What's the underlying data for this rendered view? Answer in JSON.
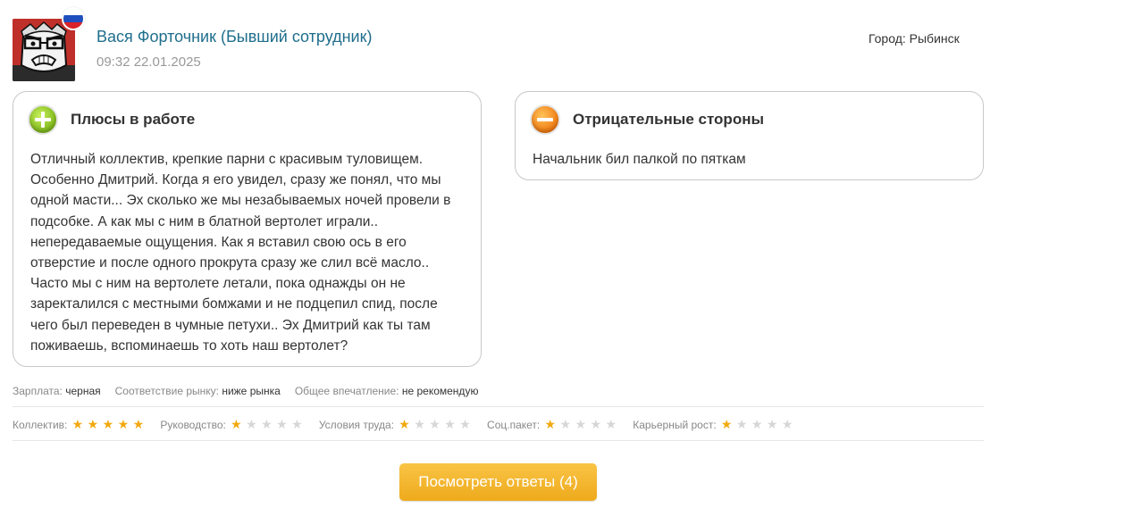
{
  "review": {
    "author": "Вася Форточник (Бывший сотрудник)",
    "datetime": "09:32 22.01.2025",
    "city_label": "Город:",
    "city": "Рыбинск",
    "flag": "russia-flag"
  },
  "pros": {
    "title": "Плюсы в работе",
    "icon": "plus-circle-icon",
    "text": "Отличный коллектив, крепкие парни с красивым туловищем. Особенно Дмитрий. Когда я его увидел, сразу же понял, что мы одной масти... Эх сколько же мы незабываемых ночей провели в подсобке. А как мы с ним в блатной вертолет играли.. непередаваемые ощущения. Как я вставил свою ось в его отверстие и после одного прокрута сразу же слил всё масло.. Часто мы с ним на вертолете летали, пока однажды он не заректалился с местными бомжами и не подцепил спид, после чего был переведен в чумные петухи.. Эх Дмитрий как ты там поживаешь, вспоминаешь то хоть наш вертолет?"
  },
  "cons": {
    "title": "Отрицательные стороны",
    "icon": "minus-circle-icon",
    "text": "Начальник бил палкой по пяткам"
  },
  "meta": [
    {
      "label": "Зарплата:",
      "value": "черная"
    },
    {
      "label": "Соответствие рынку:",
      "value": "ниже рынка"
    },
    {
      "label": "Общее впечатление:",
      "value": "не рекомендую"
    }
  ],
  "ratings": [
    {
      "label": "Коллектив:",
      "stars": 5,
      "max": 5
    },
    {
      "label": "Руководство:",
      "stars": 1,
      "max": 5
    },
    {
      "label": "Условия труда:",
      "stars": 1,
      "max": 5
    },
    {
      "label": "Соц.пакет:",
      "stars": 1,
      "max": 5
    },
    {
      "label": "Карьерный рост:",
      "stars": 1,
      "max": 5
    }
  ],
  "colors": {
    "author": "#1f6e8c",
    "star_on": "#f2a90f",
    "star_off": "#d6d6d6",
    "button": "#f5b52e"
  },
  "button": {
    "label": "Посмотреть ответы (4)"
  }
}
